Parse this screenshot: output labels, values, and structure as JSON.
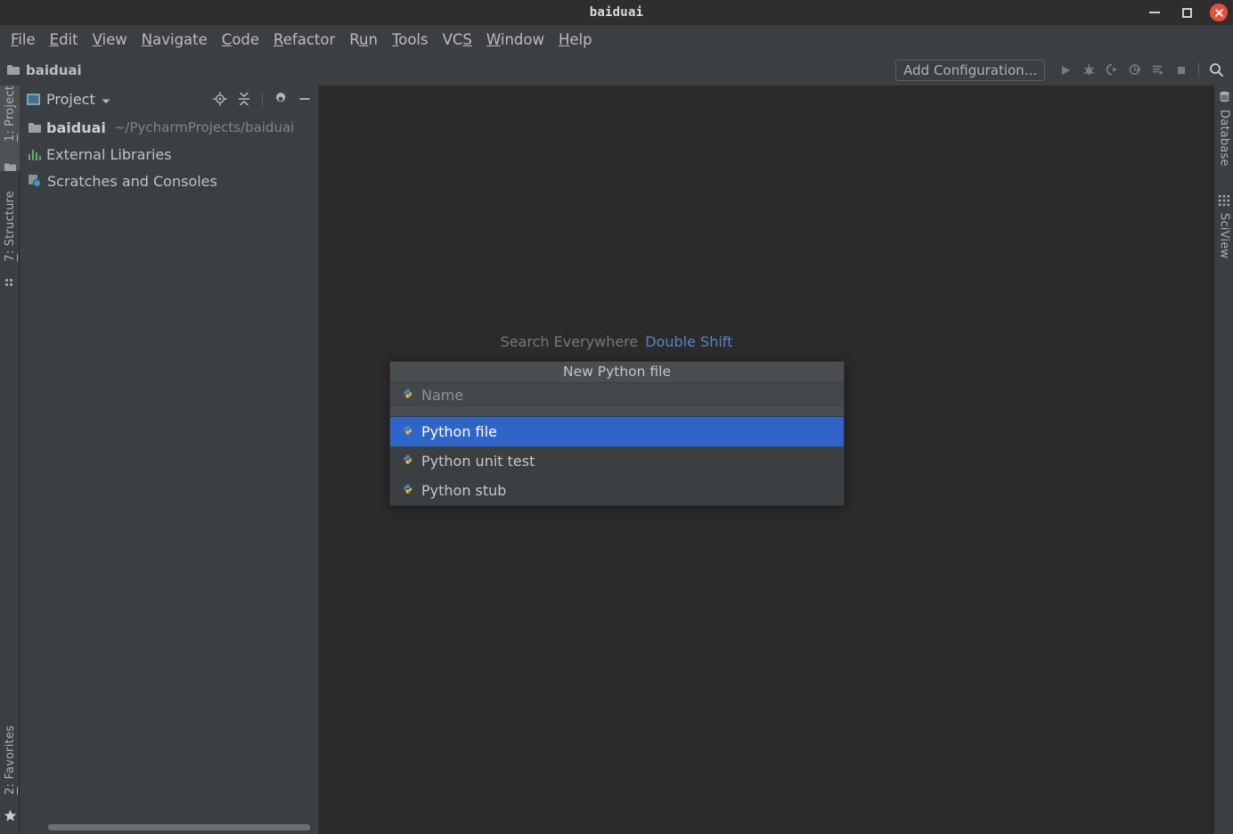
{
  "window": {
    "title": "baiduai",
    "controls": [
      {
        "name": "minimize-button",
        "label": "Minimize"
      },
      {
        "name": "maximize-button",
        "label": "Maximize"
      },
      {
        "name": "close-button",
        "label": "Close"
      }
    ]
  },
  "menubar": {
    "items": [
      {
        "label": "File",
        "mnemonic": "F"
      },
      {
        "label": "Edit",
        "mnemonic": "E"
      },
      {
        "label": "View",
        "mnemonic": "V"
      },
      {
        "label": "Navigate",
        "mnemonic": "N"
      },
      {
        "label": "Code",
        "mnemonic": "C"
      },
      {
        "label": "Refactor",
        "mnemonic": "R"
      },
      {
        "label": "Run",
        "mnemonic": "u"
      },
      {
        "label": "Tools",
        "mnemonic": "T"
      },
      {
        "label": "VCS",
        "mnemonic": "S"
      },
      {
        "label": "Window",
        "mnemonic": "W"
      },
      {
        "label": "Help",
        "mnemonic": "H"
      }
    ]
  },
  "toolbar": {
    "breadcrumb": "baiduai",
    "breadcrumb_icon": "folder-icon",
    "add_configuration_label": "Add Configuration...",
    "actions": [
      {
        "name": "run-button",
        "icon": "run-icon"
      },
      {
        "name": "debug-button",
        "icon": "debug-icon"
      },
      {
        "name": "run-coverage-button",
        "icon": "run-coverage-icon"
      },
      {
        "name": "profile-button",
        "icon": "profile-icon"
      },
      {
        "name": "run-console-button",
        "icon": "run-console-icon"
      },
      {
        "name": "stop-button",
        "icon": "stop-icon"
      },
      {
        "name": "search-button",
        "icon": "search-icon"
      }
    ]
  },
  "left_tool_strip": {
    "tabs": [
      {
        "label": "1: Project",
        "mnemonic": "1",
        "icon": "project-folder-icon",
        "active": true
      },
      {
        "label": "7: Structure",
        "mnemonic": "7",
        "icon": "structure-icon",
        "active": false
      },
      {
        "label": "2: Favorites",
        "mnemonic": "2",
        "icon": "star-icon",
        "active": false
      }
    ]
  },
  "right_tool_strip": {
    "tabs": [
      {
        "label": "Database",
        "icon": "database-icon"
      },
      {
        "label": "SciView",
        "icon": "sciview-icon"
      }
    ]
  },
  "project_panel": {
    "header": {
      "title": "Project",
      "view_icon": "project-window-icon",
      "dropdown_icon": "chevron-down-icon",
      "actions": [
        {
          "name": "select-opened-file-button",
          "icon": "locate-target-icon"
        },
        {
          "name": "collapse-all-button",
          "icon": "collapse-all-icon"
        },
        {
          "name": "settings-button",
          "icon": "gear-icon"
        },
        {
          "name": "hide-button",
          "icon": "minimize-icon"
        }
      ]
    },
    "tree": [
      {
        "label": "baiduai",
        "path": "~/PycharmProjects/baiduai",
        "icon": "folder-icon",
        "bold": true
      },
      {
        "label": "External Libraries",
        "path": "",
        "icon": "external-libraries-icon",
        "bold": false
      },
      {
        "label": "Scratches and Consoles",
        "path": "",
        "icon": "scratches-icon",
        "bold": false
      }
    ]
  },
  "editor": {
    "search_everywhere_label": "Search Everywhere",
    "search_everywhere_shortcut": "Double Shift"
  },
  "popup": {
    "title": "New Python file",
    "name_placeholder": "Name",
    "name_value": "",
    "name_icon": "python-file-icon",
    "items": [
      {
        "label": "Python file",
        "icon": "python-file-icon",
        "selected": true
      },
      {
        "label": "Python unit test",
        "icon": "python-file-icon",
        "selected": false
      },
      {
        "label": "Python stub",
        "icon": "python-file-icon",
        "selected": false
      }
    ]
  },
  "colors": {
    "titlebar_bg": "#2e2e2e",
    "chrome_bg": "#3c3f41",
    "editor_bg": "#2b2b2b",
    "selection_blue": "#2f65c8",
    "link_blue": "#5584c8",
    "text": "#bbbbbb",
    "muted_text": "#787878",
    "close_red": "#e8503a",
    "python_blue": "#3c78a8",
    "python_yellow": "#e8c244"
  }
}
